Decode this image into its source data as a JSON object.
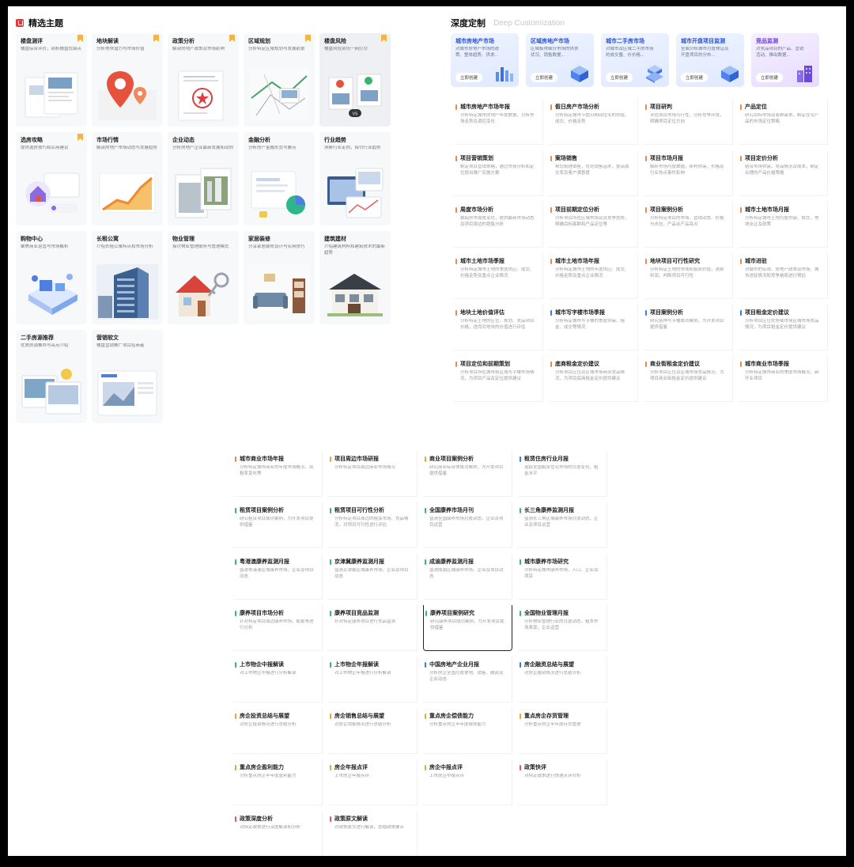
{
  "featured": {
    "title": "精选主题",
    "cards": [
      {
        "title": "楼盘测评",
        "desc": "楼盘综合评价，剖析楼盘优缺点",
        "bookmark": true,
        "image": "report-pages-image"
      },
      {
        "title": "地块解读",
        "desc": "分析地块潜力与市场价值",
        "bookmark": true,
        "image": "map-pin-image"
      },
      {
        "title": "政策分析",
        "desc": "解读房地产政策及市场影响",
        "bookmark": true,
        "image": "policy-document-image"
      },
      {
        "title": "区域规划",
        "desc": "分析特定区域规划与发展前景",
        "bookmark": true,
        "image": "region-map-image"
      },
      {
        "title": "楼盘风险",
        "desc": "楼盘风险资讯一网打尽",
        "bookmark": true,
        "image": "versus-compare-image"
      },
      {
        "title": "选房攻略",
        "desc": "提供选房技巧和实用建议",
        "bookmark": true,
        "image": "house-tips-image"
      },
      {
        "title": "市场行情",
        "desc": "解读房地产市场动态与发展趋势",
        "bookmark": false,
        "image": "rising-chart-image"
      },
      {
        "title": "企业动态",
        "desc": "分析房地产企业最新发展和动向",
        "bookmark": false,
        "image": "building-cards-image"
      },
      {
        "title": "金融分析",
        "desc": "分析房产金融形式与要点",
        "bookmark": false,
        "image": "finance-dashboard-image"
      },
      {
        "title": "行业趋势",
        "desc": "洞察行业走向，探讨行业趋势",
        "bookmark": false,
        "image": "trend-screens-image"
      },
      {
        "title": "购物中心",
        "desc": "聚焦商业运营与市场解析",
        "bookmark": false,
        "image": "mall-isometric-image"
      },
      {
        "title": "长租公寓",
        "desc": "介绍长租公寓特点和市场分析",
        "bookmark": false,
        "image": "apartment-tower-image"
      },
      {
        "title": "物业管理",
        "desc": "探讨物业管理服务与管理模式",
        "bookmark": false,
        "image": "house-keys-image"
      },
      {
        "title": "家居装修",
        "desc": "分享家居装修设计与实用技巧",
        "bookmark": false,
        "image": "living-room-image"
      },
      {
        "title": "建筑建材",
        "desc": "介绍建筑材料和建筑技术的最新趋势",
        "bookmark": false,
        "image": "villa-image"
      },
      {
        "title": "二手房源推荐",
        "desc": "优质房源推荐与亮点介绍",
        "bookmark": false,
        "image": "listing-cards-image"
      },
      {
        "title": "营销软文",
        "desc": "楼盘营销推广项目招商者",
        "bookmark": false,
        "image": "news-article-image"
      }
    ]
  },
  "deep": {
    "title": "深度定制",
    "subtitle": "Deep Customization",
    "button_label": "立即创建",
    "cards": [
      {
        "title": "城市房地产市场",
        "desc": "对城市房地产市场的政策、整体趋势、供求...",
        "icon": "city-bars-icon",
        "style": "blue"
      },
      {
        "title": "区域房地产市场",
        "desc": "区域板块细分市场的供求状况、销售数据...",
        "icon": "cube-icon",
        "style": "blue"
      },
      {
        "title": "城市二手房市场",
        "desc": "对城市及区域二手房市场的成交量、价价格...",
        "icon": "cube-stack-icon",
        "style": "blue"
      },
      {
        "title": "城市开盘项目监测",
        "desc": "全面分析城市月度预证及开盘项目的分布...",
        "icon": "cube-icon",
        "style": "blue"
      },
      {
        "title": "竞品监测",
        "desc": "对竞品项目的产品、营销活动、推出数据...",
        "icon": "buildings-icon",
        "style": "purple"
      }
    ],
    "reports": [
      {
        "title": "城市房地产市场年报",
        "desc": "分析特定城市房地产年度数据，分析市场走势及调控变化",
        "color": "#e38a4c"
      },
      {
        "title": "假日房产市场分析",
        "desc": "分析特定城市节假日期间住宅的供给、成交、价格走势",
        "color": "#e38a4c"
      },
      {
        "title": "项目研判",
        "desc": "评估项目市场可行性，分析竞争环境，明确项目定位方向",
        "color": "#e38a4c"
      },
      {
        "title": "产品定位",
        "desc": "研究目标市场及客群需求，制定住宅产品的市场定位策略",
        "color": "#e38a4c"
      },
      {
        "title": "项目营销策划",
        "desc": "制定项目营销策略，通过市场分析和定位提出推广实施方案",
        "color": "#e38a4c"
      },
      {
        "title": "案场销售",
        "desc": "帮您梳理销售，优化销售话术，提高成交率及客户满意度",
        "color": "#e38a4c"
      },
      {
        "title": "项目市场月报",
        "desc": "解析市场月度数据，研判供需，价格及行业热点事件影响",
        "color": "#e38a4c"
      },
      {
        "title": "项目定价分析",
        "desc": "结合市场供需，竞品情况及成本，制定合理的产品价格策略",
        "color": "#e38a4c"
      },
      {
        "title": "周度市场分析",
        "desc": "跟踪房市周度变化，提供最新市场动态及项目周边的销售分析",
        "color": "#e38a4c"
      },
      {
        "title": "项目前期定位分析",
        "desc": "分析项目所在区域市场及其竞争态势，明确目标客群和产品定位等",
        "color": "#e38a4c"
      },
      {
        "title": "项目案例分析",
        "desc": "分析特定项目的市场、营销动态、价格与去化，产品业产品亮点",
        "color": "#e38a4c"
      },
      {
        "title": "城市土地市场月报",
        "desc": "分析特定城市土地月度供需、成交，地块出让及政策",
        "color": "#e38a4c"
      },
      {
        "title": "城市土地市场季报",
        "desc": "分析特定城市土地的季度供应、成交、价格走势及重点企业情况",
        "color": "#e38a4c"
      },
      {
        "title": "城市土地市场年报",
        "desc": "分析特定城市土地的年度供应、成交、价格走势及重点企业情况",
        "color": "#e38a4c"
      },
      {
        "title": "地块项目可行性研究",
        "desc": "分析特定土地的市场和投资价值，测算利润，判断项目可行性",
        "color": "#e38a4c"
      },
      {
        "title": "城市进驻",
        "desc": "对城市的宏观、房地产政策及市场、城市进驻情况和竞争格局进行预估",
        "color": "#e38a4c"
      },
      {
        "title": "地块土地价值评估",
        "desc": "分析特定土地的区位、规划、竞品项目价格，进而对地块的价值进行评估",
        "color": "#e38a4c"
      },
      {
        "title": "城市写字楼市场季报",
        "desc": "分析特定城市写字楼的季度供需、租金、成交等情况",
        "color": "#3a7be0"
      },
      {
        "title": "项目案例分析",
        "desc": "研究各种写字楼成功案例，为开发项目提供借鉴",
        "color": "#3a7be0"
      },
      {
        "title": "项目租金定价建议",
        "desc": "分析项目区位优势或市场区域市场竞品情况，为项目租金定价提供建议",
        "color": "#3a7be0"
      },
      {
        "title": "项目定位和前期策划",
        "desc": "分析项目所在城市和区域写字楼市场情况，为项目产品及定位提供建议",
        "color": "#e38a4c"
      },
      {
        "title": "底商租金定价建议",
        "desc": "分析项目区位及区域市场商业竞品情况，为项目底商租金定价提供建议",
        "color": "#e38a4c"
      },
      {
        "title": "商业街租金定价建议",
        "desc": "分析项目区位及区域市场竞品情况，为项目商业街租金定价提供建议",
        "color": "#e38a4c"
      },
      {
        "title": "城市商业市场季报",
        "desc": "分析特定城市商业的季度市场概况、新开业项目",
        "color": "#e38a4c"
      }
    ]
  },
  "bottom": {
    "reports": [
      {
        "title": "城市商业市场年报",
        "desc": "分析特定城市商业的年度市场概况、出租率变化等",
        "color": "#e38a4c"
      },
      {
        "title": "项目周边市场研报",
        "desc": "分析特定项目周边商业市场情况",
        "color": "#e3a93c"
      },
      {
        "title": "商业项目案例分析",
        "desc": "研究商业综合体成功案例，为开发项目提供借鉴",
        "color": "#e3a93c"
      },
      {
        "title": "租赁住房行业月报",
        "desc": "追踪全国租赁住宅市场的月度变化，租金水平",
        "color": "#3a7be0"
      },
      {
        "title": "租赁项目案例分析",
        "desc": "研究租赁项目成功案例，为开发项目提供借鉴",
        "color": "#3ab08a"
      },
      {
        "title": "租赁项目可行性分析",
        "desc": "分析特定项目周边的租赁市场、竞品情况，对项目可行性进行评估",
        "color": "#3ab08a"
      },
      {
        "title": "全国康养市场月刊",
        "desc": "监测全国康养市场月度动态，企业及项目运营",
        "color": "#3ab08a"
      },
      {
        "title": "长三角康养监测月报",
        "desc": "监测长三角区域康养市场月度动态，企业及项目运营",
        "color": "#3ab08a"
      },
      {
        "title": "粤港澳康养监测月报",
        "desc": "监测粤港澳区域康养市场，企业及项目动态",
        "color": "#3ab08a"
      },
      {
        "title": "京津冀康养监测月报",
        "desc": "监测京津冀区域康养市场，企业及项目动态",
        "color": "#3ab08a"
      },
      {
        "title": "成渝康养监测月报",
        "desc": "监测成渝区域康养市场，企业及项目动态",
        "color": "#3ab08a"
      },
      {
        "title": "城市康养市场研究",
        "desc": "分析特定城市康养市场，人口、企业及项目",
        "color": "#3ab08a"
      },
      {
        "title": "康养项目市场分析",
        "desc": "针对特定项目周边康养市场，配套等进行分析",
        "color": "#3ab08a"
      },
      {
        "title": "康养项目竞品监测",
        "desc": "针对特定康养项目进行竞品监测",
        "color": "#3ab08a"
      },
      {
        "title": "康养项目案例研究",
        "desc": "研究康养项目成功案例，为开发项目提供借鉴",
        "color": "#3ab08a",
        "selected": true
      },
      {
        "title": "全国物业管理月报",
        "desc": "分析物业管理行业的月度动态，租本市场表现，企业运营",
        "color": "#3ab08a"
      },
      {
        "title": "上市物企中报解读",
        "desc": "对上市物企中报进行分析解读",
        "color": "#3ab08a"
      },
      {
        "title": "上市物企年报解读",
        "desc": "对上市物企年报进行分析解读",
        "color": "#3ab08a"
      },
      {
        "title": "中国房地产企业月报",
        "desc": "分析房企全国月度拿地、销售、融资及企业动态",
        "color": "#3a7be0"
      },
      {
        "title": "房企融资总结与展望",
        "desc": "对房企融资情况进行总结分析",
        "color": "#3a7be0"
      },
      {
        "title": "房企投资总结与展望",
        "desc": "对房企投资情况进行总结分析",
        "color": "#e3a93c"
      },
      {
        "title": "房企销售总结与展望",
        "desc": "对房企销售情况进行总结分析",
        "color": "#e3a93c"
      },
      {
        "title": "重点房企偿债能力",
        "desc": "分析重点房企半年度偿债能力",
        "color": "#e3a93c"
      },
      {
        "title": "重点房企存货管理",
        "desc": "分析重点房企半年度存货管理",
        "color": "#e3a93c"
      },
      {
        "title": "重点房企盈利能力",
        "desc": "分析重点房企半年度盈利能力",
        "color": "#e3a93c"
      },
      {
        "title": "房企年报点评",
        "desc": "上市房企年报点评",
        "color": "#e3a93c"
      },
      {
        "title": "房企中报点评",
        "desc": "上市房企中报点评",
        "color": "#e3a93c"
      },
      {
        "title": "政策快评",
        "desc": "对特定政策进行快速点评分析",
        "color": "#e05a5a"
      },
      {
        "title": "政策深度分析",
        "desc": "对特定政策进行深度解读和分析",
        "color": "#e05a5a"
      },
      {
        "title": "政策原文解读",
        "desc": "对政策原文进行解读，总结政策要点",
        "color": "#e05a5a"
      }
    ]
  }
}
